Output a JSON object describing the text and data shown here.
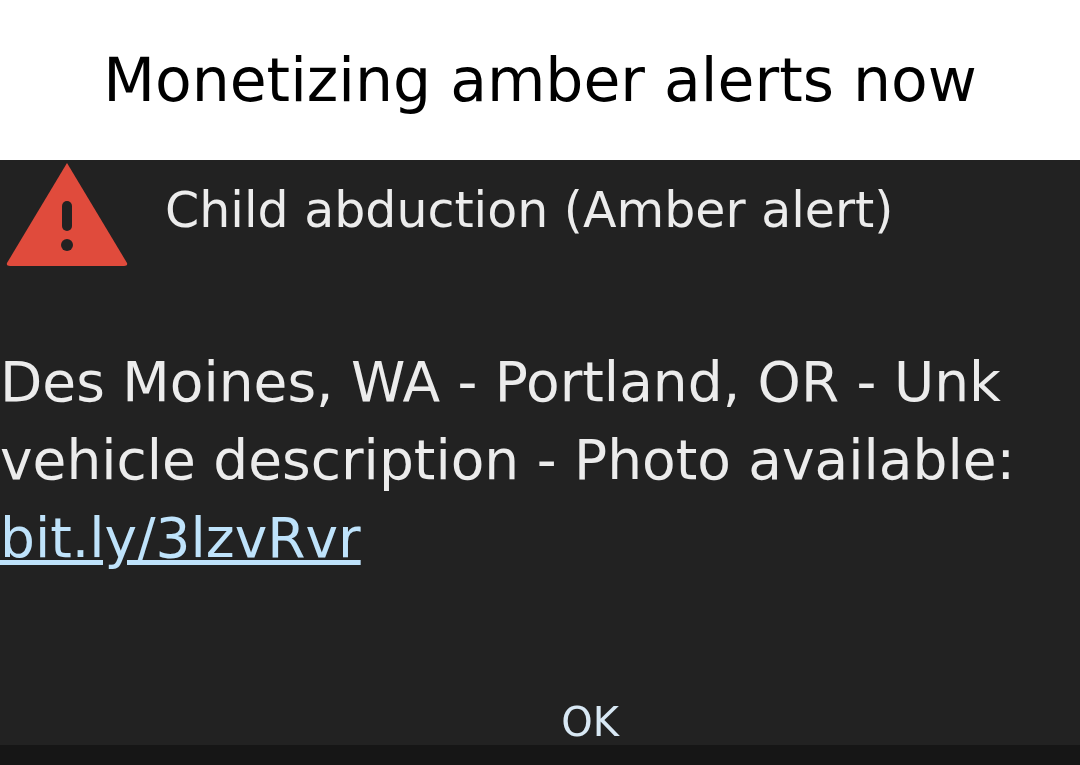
{
  "caption": "Monetizing amber alerts now",
  "alert": {
    "title": "Child abduction (Amber alert)",
    "body_lines": [
      "Des Moines, WA - Portland, OR - Unk",
      "vehicle description - Photo available:"
    ],
    "link": "bit.ly/3lzvRvr",
    "buttons": [
      "OK"
    ]
  }
}
